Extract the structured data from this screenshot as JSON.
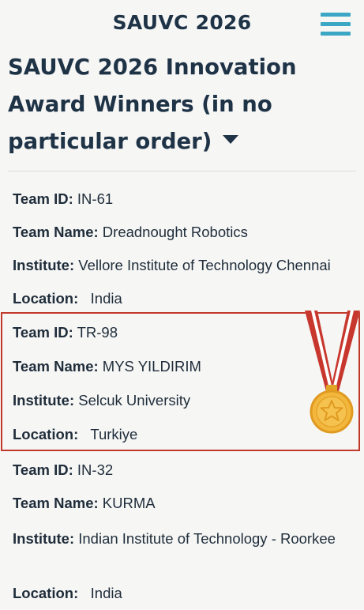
{
  "header": {
    "brand": "SAUVC 2026",
    "menu_icon": "hamburger-menu-icon",
    "accent_color": "#3ba7c4"
  },
  "page": {
    "title": "SAUVC 2026 Innovation Award Winners (in no particular order)",
    "dropdown_icon": "caret-down-icon"
  },
  "labels": {
    "team_id": "Team ID:",
    "team_name": "Team Name:",
    "institute": "Institute:",
    "location": "Location:"
  },
  "entries": [
    {
      "team_id": "IN-61",
      "team_name": "Dreadnought Robotics",
      "institute": "Vellore Institute of Technology Chennai",
      "location": "India",
      "highlighted": false
    },
    {
      "team_id": "TR-98",
      "team_name": "MYS YILDIRIM",
      "institute": "Selcuk University",
      "location": "Turkiye",
      "highlighted": true,
      "badge_icon": "gold-medal-icon",
      "highlight_color": "#c0392b"
    },
    {
      "team_id": "IN-32",
      "team_name": "KURMA",
      "institute": "Indian Institute of Technology - Roorkee",
      "location": "India",
      "highlighted": false
    }
  ]
}
